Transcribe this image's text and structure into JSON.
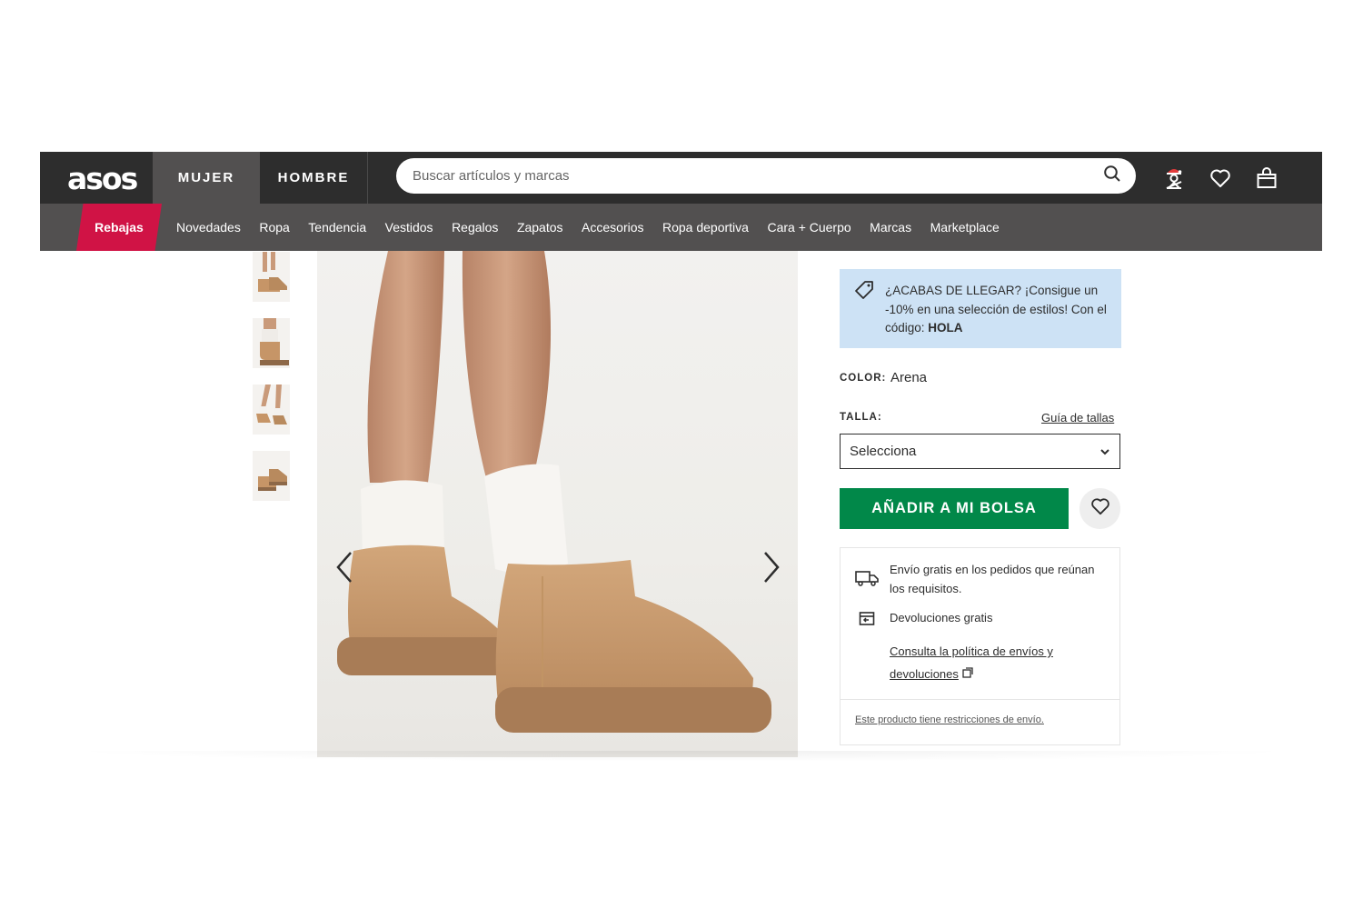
{
  "header": {
    "logo": "asos",
    "tabs": [
      "MUJER",
      "HOMBRE"
    ],
    "search_placeholder": "Buscar artículos y marcas"
  },
  "categories": {
    "sale": "Rebajas",
    "items": [
      "Novedades",
      "Ropa",
      "Tendencia",
      "Vestidos",
      "Regalos",
      "Zapatos",
      "Accesorios",
      "Ropa deportiva",
      "Cara + Cuerpo",
      "Marcas",
      "Marketplace"
    ]
  },
  "promo": {
    "text": "¿ACABAS DE LLEGAR? ¡Consigue un -10% en una selección de estilos! Con el código: ",
    "code": "HOLA"
  },
  "product": {
    "color_label": "COLOR:",
    "color_value": "Arena",
    "size_label": "TALLA:",
    "size_guide": "Guía de tallas",
    "size_select": "Selecciona",
    "add_to_bag": "AÑADIR A MI BOLSA"
  },
  "delivery": {
    "free_shipping": "Envío gratis en los pedidos que reúnan los requisitos.",
    "free_returns": "Devoluciones gratis",
    "policy_link": "Consulta la política de envíos y devoluciones",
    "restriction": "Este producto tiene restricciones de envío."
  },
  "colors": {
    "topbar": "#2d2d2d",
    "catbar": "#525050",
    "sale": "#d01345",
    "add_button": "#018849",
    "promo_bg": "#cde2f5"
  },
  "icons": [
    "search-icon",
    "account-icon",
    "heart-icon",
    "bag-icon",
    "tag-icon",
    "truck-icon",
    "returns-icon",
    "external-link-icon",
    "chevron-left-icon",
    "chevron-right-icon",
    "chevron-down-icon"
  ]
}
